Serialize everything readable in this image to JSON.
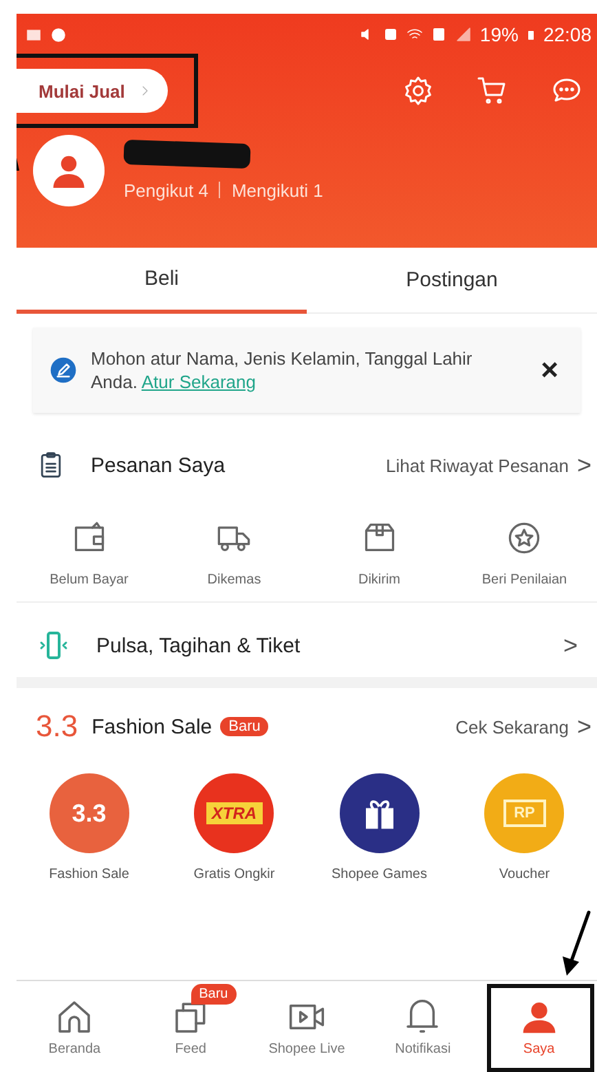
{
  "status_bar": {
    "battery": "19%",
    "time": "22:08"
  },
  "header": {
    "sell_button": {
      "label": "Mulai Jual",
      "highlighted": true
    },
    "name_redacted": true,
    "followers": "Pengikut 4",
    "following": "Mengikuti 1"
  },
  "tabs": [
    {
      "label": "Beli",
      "selected": true
    },
    {
      "label": "Postingan",
      "selected": false
    }
  ],
  "notice": {
    "text": "Mohon atur Nama, Jenis Kelamin, Tanggal Lahir Anda.",
    "link": "Atur Sekarang",
    "close": "×"
  },
  "orders": {
    "title": "Pesanan Saya",
    "link": "Lihat Riwayat Pesanan",
    "chevron": ">",
    "items": [
      {
        "kind": "wallet",
        "label": "Belum Bayar"
      },
      {
        "kind": "truck",
        "label": "Dikemas"
      },
      {
        "kind": "box",
        "label": "Dikirim"
      },
      {
        "kind": "star",
        "label": "Beri Penilaian"
      }
    ]
  },
  "pulsa": {
    "title": "Pulsa, Tagihan & Tiket",
    "chevron": ">"
  },
  "fashion": {
    "prefix": "3.3",
    "title": "Fashion Sale",
    "badge": "Baru",
    "link": "Cek Sekarang",
    "chevron": ">",
    "items": [
      {
        "kind": "sale",
        "icon_text": "3.3",
        "label": "Fashion Sale",
        "color": "#e8623e"
      },
      {
        "kind": "shipping",
        "icon_text": "XTRA",
        "label": "Gratis Ongkir",
        "color": "#e8321e"
      },
      {
        "kind": "gift",
        "label": "Shopee Games",
        "color": "#2a2f86"
      },
      {
        "kind": "voucher",
        "icon_text": "RP",
        "label": "Voucher",
        "color": "#f2ac16"
      }
    ]
  },
  "nav": [
    {
      "kind": "home",
      "label": "Beranda",
      "selected": false,
      "highlighted": false
    },
    {
      "kind": "feed",
      "label": "Feed",
      "badge": "Baru",
      "selected": false,
      "highlighted": false
    },
    {
      "kind": "live",
      "label": "Shopee Live",
      "selected": false,
      "highlighted": false
    },
    {
      "kind": "bell",
      "label": "Notifikasi",
      "selected": false,
      "highlighted": false
    },
    {
      "kind": "person",
      "label": "Saya",
      "selected": true,
      "highlighted": true
    }
  ]
}
